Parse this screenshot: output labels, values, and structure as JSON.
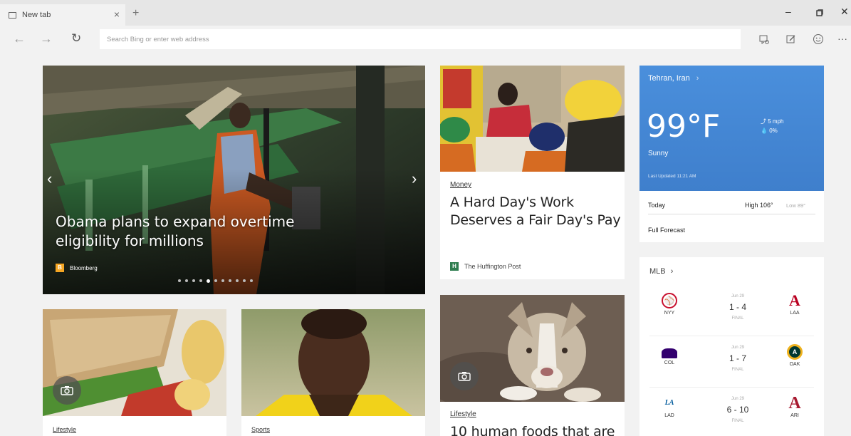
{
  "browser": {
    "tab_title": "New tab",
    "new_tab_symbol": "+",
    "close_symbol": "×",
    "minimize_symbol": "–",
    "restore_symbol": "▫",
    "window_close_symbol": "✕",
    "address_placeholder": "Search Bing or enter web address",
    "more_symbol": "···"
  },
  "hero": {
    "headline_line1": "Obama plans to expand overtime",
    "headline_line2": "eligibility for millions",
    "source": "Bloomberg",
    "source_letter": "B",
    "slide_count": 11,
    "active_slide": 4
  },
  "money_card": {
    "category": "Money",
    "headline_line1": "A Hard Day's Work",
    "headline_line2": "Deserves a Fair Day's Pay",
    "source": "The Huffington Post",
    "source_letter": "H"
  },
  "weather": {
    "location": "Tehran, Iran",
    "location_chevron": "›",
    "temperature": "99°F",
    "condition": "Sunny",
    "wind": "5 mph",
    "precip": "0%",
    "last_updated": "Last Updated 11:21 AM",
    "today_label": "Today",
    "high": "High 106°",
    "low": "Low 89°",
    "full_forecast": "Full Forecast"
  },
  "mlb": {
    "title": "MLB",
    "chevron": "›",
    "games": [
      {
        "date": "Jun 29",
        "home": "NYY",
        "away": "LAA",
        "score": "1 - 4",
        "status": "FINAL"
      },
      {
        "date": "Jun 29",
        "home": "COL",
        "away": "OAK",
        "score": "1 - 7",
        "status": "FINAL"
      },
      {
        "date": "Jun 29",
        "home": "LAD",
        "away": "ARI",
        "score": "6 - 10",
        "status": "FINAL"
      }
    ]
  },
  "lifestyle_card_1": {
    "category": "Lifestyle"
  },
  "sports_card": {
    "category": "Sports"
  },
  "lifestyle_card_2": {
    "category": "Lifestyle",
    "headline": "10 human foods that are"
  },
  "colors": {
    "weather_blue": "#4a8fdc",
    "huffpost_green": "#2e7d4f",
    "bloomberg_orange": "#f5a623"
  }
}
